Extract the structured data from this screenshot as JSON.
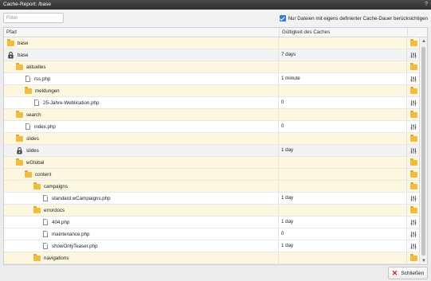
{
  "window": {
    "title": "Cache-Report: /base",
    "help_label": "?"
  },
  "toolbar": {
    "filter_placeholder": "Filter",
    "only_custom_label": "Nur Dateien mit eigens definierter Cache-Dauer berücksichtigen",
    "only_custom_checked": true
  },
  "grid": {
    "columns": [
      "Pfad",
      "Gültigkeit des Caches"
    ],
    "rows": [
      {
        "name": "base",
        "type": "folder",
        "level": 0,
        "validity": ""
      },
      {
        "name": "base",
        "type": "cached",
        "level": 0,
        "validity": "7 days"
      },
      {
        "name": "aktuelles",
        "type": "folder",
        "level": 1,
        "validity": ""
      },
      {
        "name": "rss.php",
        "type": "file",
        "level": 2,
        "validity": "1 minute"
      },
      {
        "name": "meldungen",
        "type": "folder",
        "level": 2,
        "validity": ""
      },
      {
        "name": "25-Jahre-Weblication.php",
        "type": "file",
        "level": 3,
        "validity": "0"
      },
      {
        "name": "search",
        "type": "folder",
        "level": 1,
        "validity": ""
      },
      {
        "name": "index.php",
        "type": "file",
        "level": 2,
        "validity": "0"
      },
      {
        "name": "slides",
        "type": "folder",
        "level": 1,
        "validity": ""
      },
      {
        "name": "slides",
        "type": "cached",
        "level": 1,
        "validity": "1 day"
      },
      {
        "name": "wGlobal",
        "type": "folder",
        "level": 1,
        "validity": ""
      },
      {
        "name": "content",
        "type": "folder",
        "level": 2,
        "validity": ""
      },
      {
        "name": "campaigns",
        "type": "folder",
        "level": 3,
        "validity": ""
      },
      {
        "name": "standard.wCampaigns.php",
        "type": "file",
        "level": 4,
        "validity": "1 day"
      },
      {
        "name": "errordocs",
        "type": "folder",
        "level": 3,
        "validity": ""
      },
      {
        "name": "404.php",
        "type": "file",
        "level": 4,
        "validity": "1 day"
      },
      {
        "name": "maintenance.php",
        "type": "file",
        "level": 4,
        "validity": "0"
      },
      {
        "name": "showOnlyTeaser.php",
        "type": "file",
        "level": 4,
        "validity": "1 day"
      },
      {
        "name": "navigations",
        "type": "folder",
        "level": 3,
        "validity": ""
      }
    ]
  },
  "icons": {
    "folder": "folder-icon",
    "file": "file-icon",
    "cached": "cache-settings-icon",
    "adjust": "adjust-sliders-icon"
  },
  "colors": {
    "folder": "#f2bc42",
    "folder_row": "#fdf7e0",
    "checkbox": "#2f7fd1",
    "close_x": "#d21d1d"
  },
  "footer": {
    "close_label": "Schließen"
  }
}
